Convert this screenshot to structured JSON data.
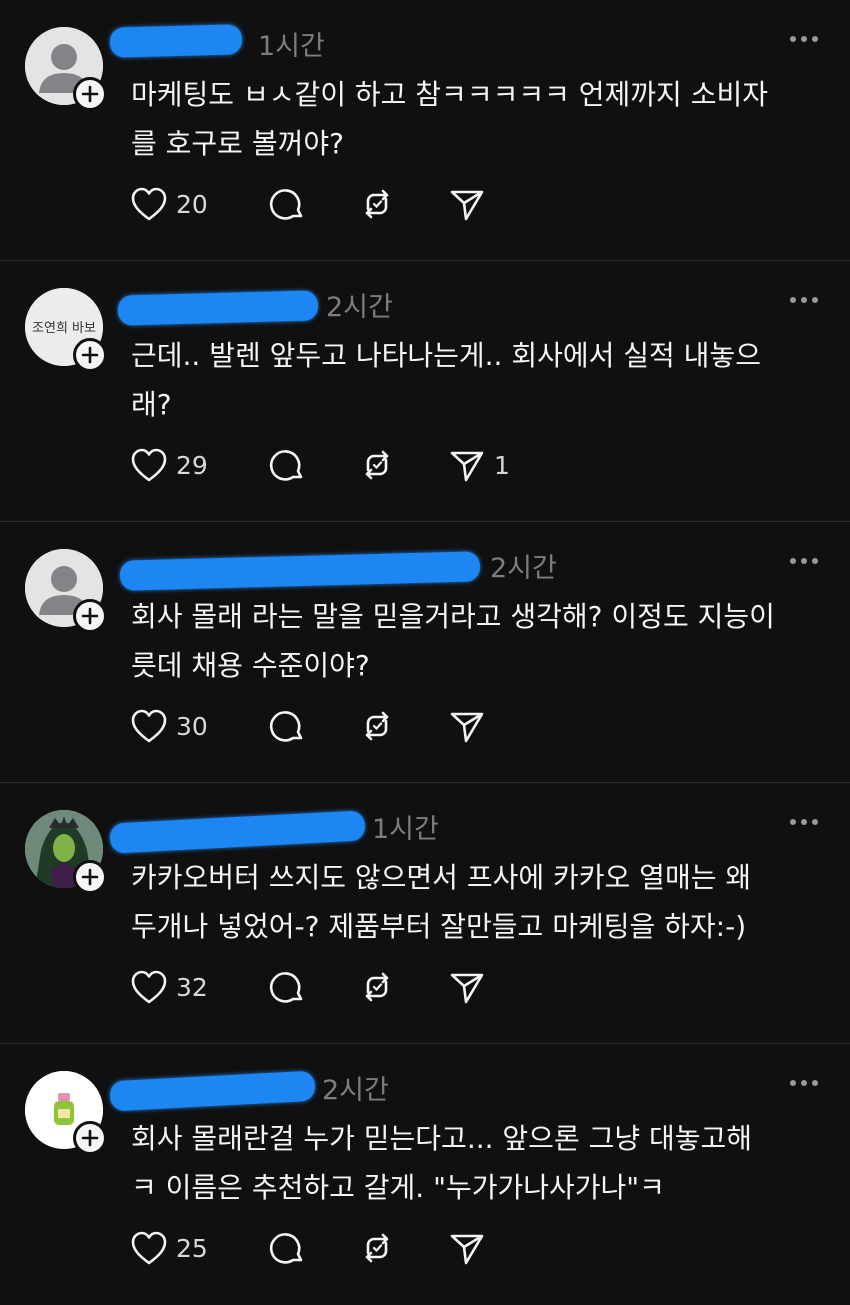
{
  "icons": {
    "avatar_default": "default-avatar-icon",
    "follow": "plus-icon",
    "more": "more-horizontal-icon",
    "like": "heart-icon",
    "reply": "comment-bubble-icon",
    "repost": "repost-icon",
    "share": "send-icon"
  },
  "colors": {
    "background": "#101010",
    "text": "#f3f5f7",
    "muted": "#7d7d7d",
    "redaction": "#1e86f2"
  },
  "posts": [
    {
      "username": "",
      "time": "1시간",
      "avatar": "default",
      "text": "마케팅도 ㅂㅅ같이 하고 참ㅋㅋㅋㅋㅋ 언제까지 소비자\n를 호구로 볼꺼야?",
      "likes": "20",
      "replies": "",
      "reposts": "",
      "shares": ""
    },
    {
      "username": "",
      "time": "2시간",
      "avatar": "handwriting",
      "avatar_text": "조연희 바보",
      "text": "근데.. 발렌 앞두고 나타나는게.. 회사에서 실적 내놓으\n래?",
      "likes": "29",
      "replies": "",
      "reposts": "",
      "shares": "1"
    },
    {
      "username": "",
      "time": "2시간",
      "avatar": "default",
      "text": "회사 몰래 라는 말을 믿을거라고 생각해? 이정도 지능이\n릇데 채용 수준이야?",
      "likes": "30",
      "replies": "",
      "reposts": "",
      "shares": ""
    },
    {
      "username": "",
      "time": "1시간",
      "avatar": "queen",
      "text": "카카오버터 쓰지도 않으면서 프사에 카카오 열매는 왜\n두개나 넣었어-? 제품부터 잘만들고 마케팅을 하자:-)",
      "likes": "32",
      "replies": "",
      "reposts": "",
      "shares": ""
    },
    {
      "username": "",
      "time": "2시간",
      "avatar": "bottle",
      "text": "회사 몰래란걸 누가 믿는다고... 앞으론 그냥 대놓고해\nㅋ 이름은 추천하고 갈게. \"누가가나사가나\"ㅋ",
      "likes": "25",
      "replies": "",
      "reposts": "",
      "shares": ""
    }
  ]
}
